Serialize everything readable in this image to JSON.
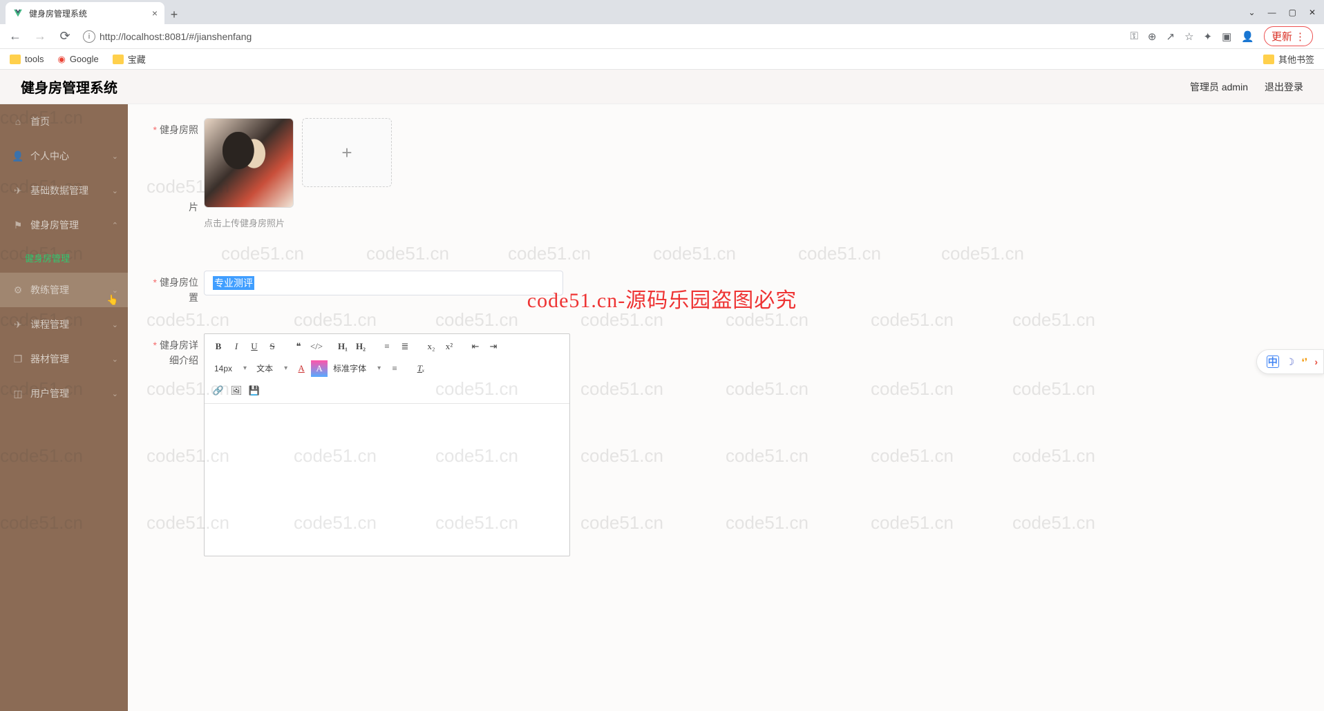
{
  "browser": {
    "tab_title": "健身房管理系统",
    "url": "http://localhost:8081/#/jianshenfang",
    "update_label": "更新",
    "bookmarks": {
      "tools": "tools",
      "google": "Google",
      "treasure": "宝藏",
      "other": "其他书签"
    }
  },
  "header": {
    "title": "健身房管理系统",
    "user_label": "管理员 admin",
    "logout": "退出登录"
  },
  "sidebar": {
    "home": "首页",
    "personal": "个人中心",
    "base_data": "基础数据管理",
    "gym_mgmt": "健身房管理",
    "gym_mgmt_sub": "健身房管理",
    "coach": "教练管理",
    "course": "课程管理",
    "equipment": "器材管理",
    "user": "用户管理"
  },
  "form": {
    "photo_label": "健身房照",
    "photo_label2": "片",
    "upload_hint": "点击上传健身房照片",
    "location_label": "健身房位",
    "location_label2": "置",
    "location_value": "专业测评",
    "detail_label": "健身房详",
    "detail_label2": "细介绍"
  },
  "editor_toolbar": {
    "size": "14px",
    "text": "文本",
    "font": "标准字体"
  },
  "watermark": {
    "text": "code51.cn",
    "center": "code51.cn-源码乐园盗图必究"
  },
  "float_widget": {
    "cn": "中"
  }
}
